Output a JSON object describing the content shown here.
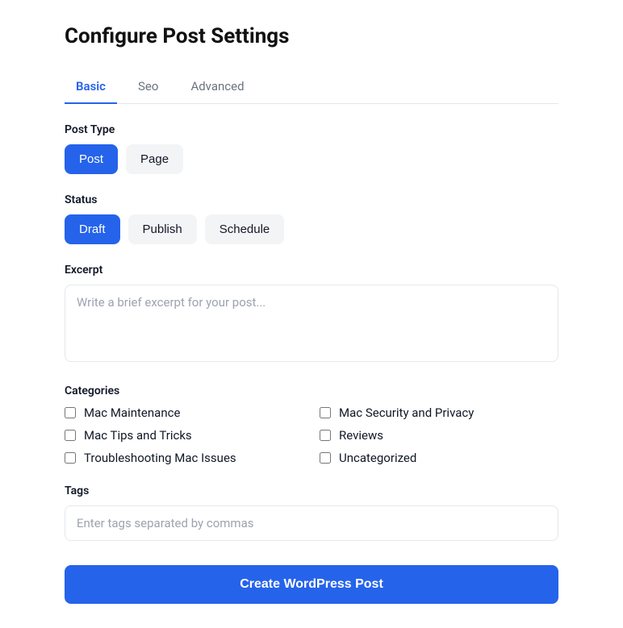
{
  "title": "Configure Post Settings",
  "tabs": [
    {
      "label": "Basic",
      "active": true
    },
    {
      "label": "Seo",
      "active": false
    },
    {
      "label": "Advanced",
      "active": false
    }
  ],
  "postType": {
    "label": "Post Type",
    "options": [
      {
        "label": "Post",
        "selected": true
      },
      {
        "label": "Page",
        "selected": false
      }
    ]
  },
  "status": {
    "label": "Status",
    "options": [
      {
        "label": "Draft",
        "selected": true
      },
      {
        "label": "Publish",
        "selected": false
      },
      {
        "label": "Schedule",
        "selected": false
      }
    ]
  },
  "excerpt": {
    "label": "Excerpt",
    "placeholder": "Write a brief excerpt for your post..."
  },
  "categories": {
    "label": "Categories",
    "items": [
      "Mac Maintenance",
      "Mac Security and Privacy",
      "Mac Tips and Tricks",
      "Reviews",
      "Troubleshooting Mac Issues",
      "Uncategorized"
    ]
  },
  "tags": {
    "label": "Tags",
    "placeholder": "Enter tags separated by commas"
  },
  "submit": {
    "label": "Create WordPress Post"
  }
}
